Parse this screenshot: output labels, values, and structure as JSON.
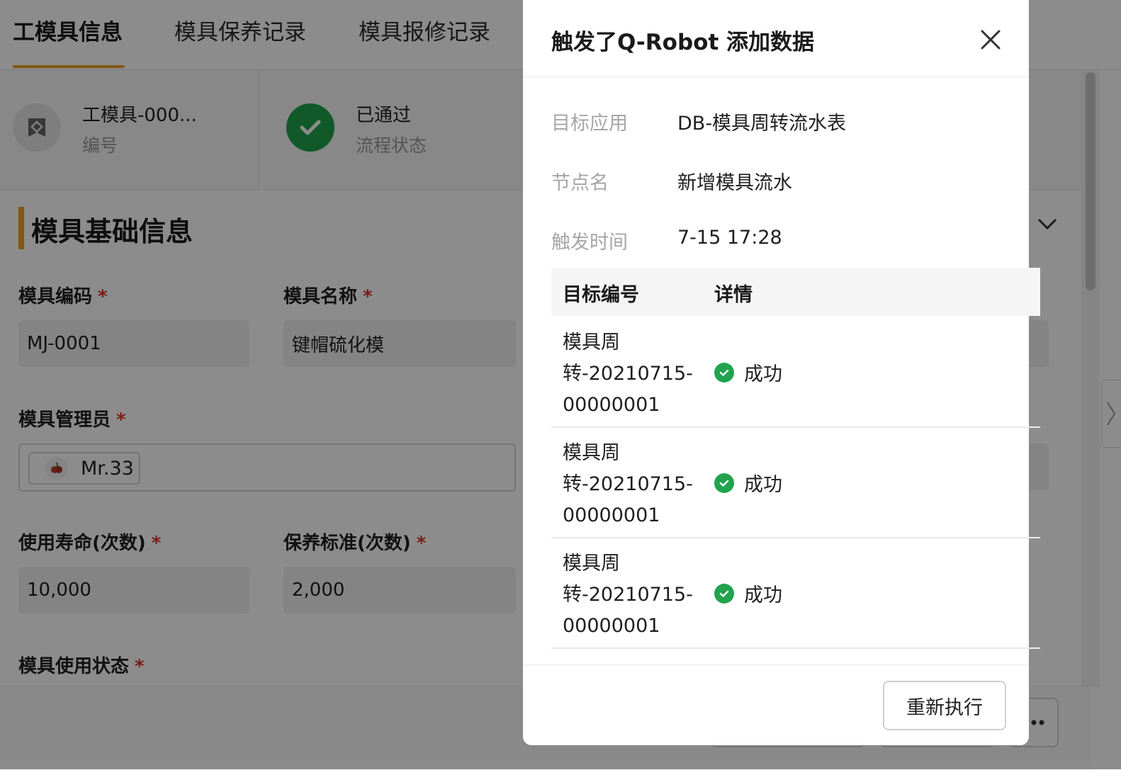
{
  "tabs": [
    {
      "label": "工模具信息",
      "active": true
    },
    {
      "label": "模具保养记录",
      "active": false
    },
    {
      "label": "模具报修记录",
      "active": false
    }
  ],
  "summary": {
    "record": {
      "title": "工模具-000...",
      "sub": "编号"
    },
    "flow": {
      "title": "已通过",
      "sub": "流程状态"
    }
  },
  "section": {
    "title": "模具基础信息"
  },
  "form": {
    "mold_code": {
      "label": "模具编码",
      "required": "*",
      "value": "MJ-0001"
    },
    "mold_name": {
      "label": "模具名称",
      "required": "*",
      "value": "键帽硫化模"
    },
    "mold_admin": {
      "label": "模具管理员",
      "required": "*",
      "value": "Mr.33"
    },
    "life": {
      "label": "使用寿命(次数)",
      "required": "*",
      "value": "10,000"
    },
    "maint_std": {
      "label": "保养标准(次数)",
      "required": "*",
      "value": "2,000"
    },
    "use_status": {
      "label": "模具使用状态",
      "required": "*"
    }
  },
  "modal": {
    "title": "触发了Q-Robot 添加数据",
    "fields": [
      {
        "label": "目标应用",
        "value": "DB-模具周转流水表"
      },
      {
        "label": "节点名",
        "value": "新增模具流水"
      },
      {
        "label": "触发时间",
        "value": "7-15 17:28"
      }
    ],
    "table": {
      "headers": [
        "目标编号",
        "详情"
      ],
      "rows": [
        {
          "id_line1": "模具周",
          "id_line2": "转-20210715-",
          "id_line3": "00000001",
          "status": "成功"
        },
        {
          "id_line1": "模具周",
          "id_line2": "转-20210715-",
          "id_line3": "00000001",
          "status": "成功"
        },
        {
          "id_line1": "模具周",
          "id_line2": "转-20210715-",
          "id_line3": "00000001",
          "status": "成功"
        }
      ]
    },
    "rerun_label": "重新执行"
  },
  "colors": {
    "accent": "#f0a020",
    "success": "#22a34e",
    "required": "#e0362c"
  }
}
